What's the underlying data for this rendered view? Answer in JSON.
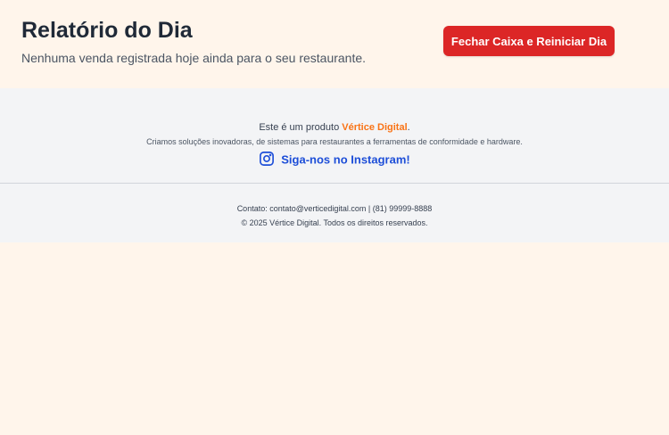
{
  "header": {
    "title": "Relatório do Dia",
    "subtitle": "Nenhuma venda registrada hoje ainda para o seu restaurante.",
    "close_button_label": "Fechar Caixa e Reiniciar Dia"
  },
  "footer": {
    "product_prefix": "Este é um produto ",
    "brand_name": "Vértice Digital",
    "product_suffix": ".",
    "tagline": "Criamos soluções inovadoras, de sistemas para restaurantes a ferramentas de conformidade e hardware.",
    "instagram_label": "Siga-nos no Instagram!",
    "instagram_icon": "instagram-icon",
    "contact": "Contato: contato@verticedigital.com | (81) 99999-8888",
    "copyright": "© 2025 Vértice Digital. Todos os direitos reservados."
  },
  "colors": {
    "page_background": "#fff5eb",
    "footer_background": "#f3f4f6",
    "danger": "#dc2626",
    "brand_accent": "#f97316",
    "link": "#1d4ed8",
    "title_text": "#1f2937"
  }
}
